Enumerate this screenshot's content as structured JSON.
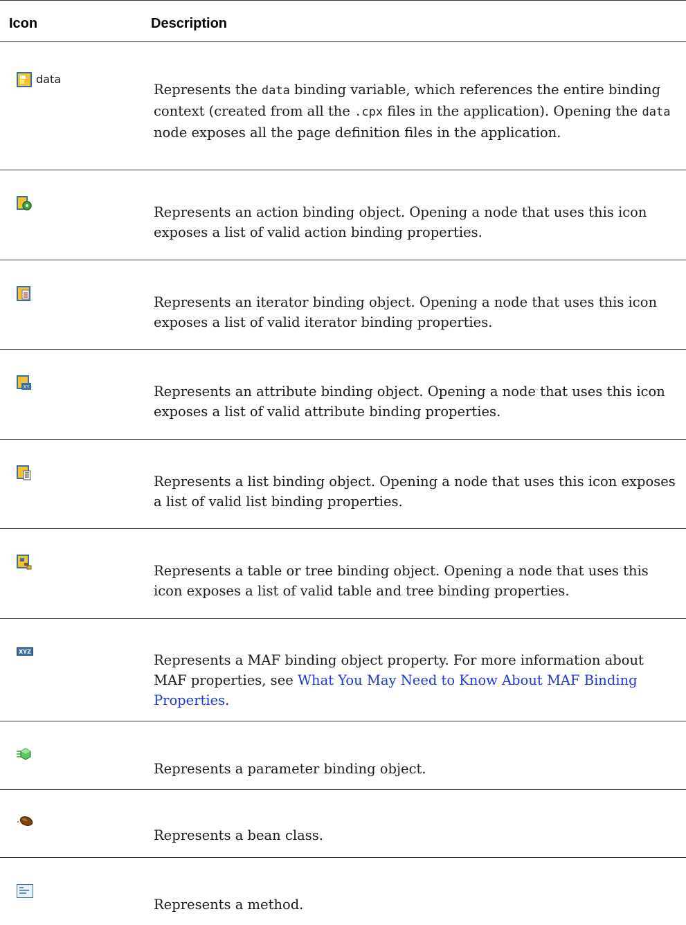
{
  "header": {
    "col_icon": "Icon",
    "col_description": "Description"
  },
  "rows": [
    {
      "icon": "data-binding-variable-icon",
      "icon_label": "data",
      "pre": "Represents the ",
      "code1": "data",
      "mid1": " binding variable, which references the entire binding context (created from all the ",
      "code2": ".cpx",
      "mid2": " files in the application). Opening the ",
      "code3": "data",
      "post": " node exposes all the page definition files in the application."
    },
    {
      "icon": "action-binding-icon",
      "text": "Represents an action binding object. Opening a node that uses this icon exposes a list of valid action binding properties."
    },
    {
      "icon": "iterator-binding-icon",
      "text": "Represents an iterator binding object. Opening a node that uses this icon exposes a list of valid iterator binding properties."
    },
    {
      "icon": "attribute-binding-icon",
      "text": "Represents an attribute binding object. Opening a node that uses this icon exposes a list of valid attribute binding properties."
    },
    {
      "icon": "list-binding-icon",
      "text": "Represents a list binding object. Opening a node that uses this icon exposes a list of valid list binding properties."
    },
    {
      "icon": "table-tree-binding-icon",
      "text": "Represents a table or tree binding object. Opening a node that uses this icon exposes a list of valid table and tree binding properties."
    },
    {
      "icon": "maf-binding-property-icon",
      "text": "Represents a MAF binding object property. For more information about MAF properties, see ",
      "link": "What You May Need to Know About MAF Binding Properties",
      "after": "."
    },
    {
      "icon": "parameter-binding-icon",
      "text": "Represents a parameter binding object."
    },
    {
      "icon": "bean-class-icon",
      "text": "Represents a bean class."
    },
    {
      "icon": "method-icon",
      "text": "Represents a method."
    }
  ]
}
